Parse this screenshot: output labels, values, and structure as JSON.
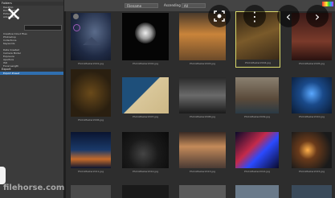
{
  "sidebar": {
    "top_rows": [
      "Folders",
      "Desktop",
      "Documents",
      "Pictures",
      "Adobe Bridge"
    ],
    "favorites": [
      "Creative Cloud Files",
      "Photoshop",
      "Collections",
      "Keywords"
    ],
    "metadata_rows": [
      "Date Created",
      "Camera Model",
      "Exposure",
      "Aperture",
      "ISO",
      "Focal Length"
    ],
    "bottom_rows": [
      "Export"
    ],
    "selected_row": "Export Preset"
  },
  "toolbar": {
    "sort_select": "Filename",
    "sort_label": "Ascending",
    "filter_select": "All"
  },
  "overlay": {
    "close_icon": "✕",
    "more_icon": "⋮",
    "prev_icon": "‹",
    "next_icon": "›",
    "watermark": "filehorse.com"
  },
  "thumbnails": [
    {
      "caption": "PhotoMaster2001.jpg"
    },
    {
      "caption": "PhotoMaster2002.jpg"
    },
    {
      "caption": "PhotoMaster2003.jpg"
    },
    {
      "caption": "PhotoMaster2004.jpg"
    },
    {
      "caption": "PhotoMaster2005.jpg"
    },
    {
      "caption": "PhotoMaster2006.jpg"
    },
    {
      "caption": "PhotoMaster2007.jpg"
    },
    {
      "caption": "PhotoMaster2008.jpg"
    },
    {
      "caption": "PhotoMaster2009.jpg"
    },
    {
      "caption": "PhotoMaster2010.jpg"
    },
    {
      "caption": "PhotoMaster2011.jpg"
    },
    {
      "caption": "PhotoMaster2012.jpg"
    },
    {
      "caption": "PhotoMaster2013.jpg"
    },
    {
      "caption": "PhotoMaster2014.jpg"
    },
    {
      "caption": "PhotoMaster2015.jpg"
    }
  ]
}
